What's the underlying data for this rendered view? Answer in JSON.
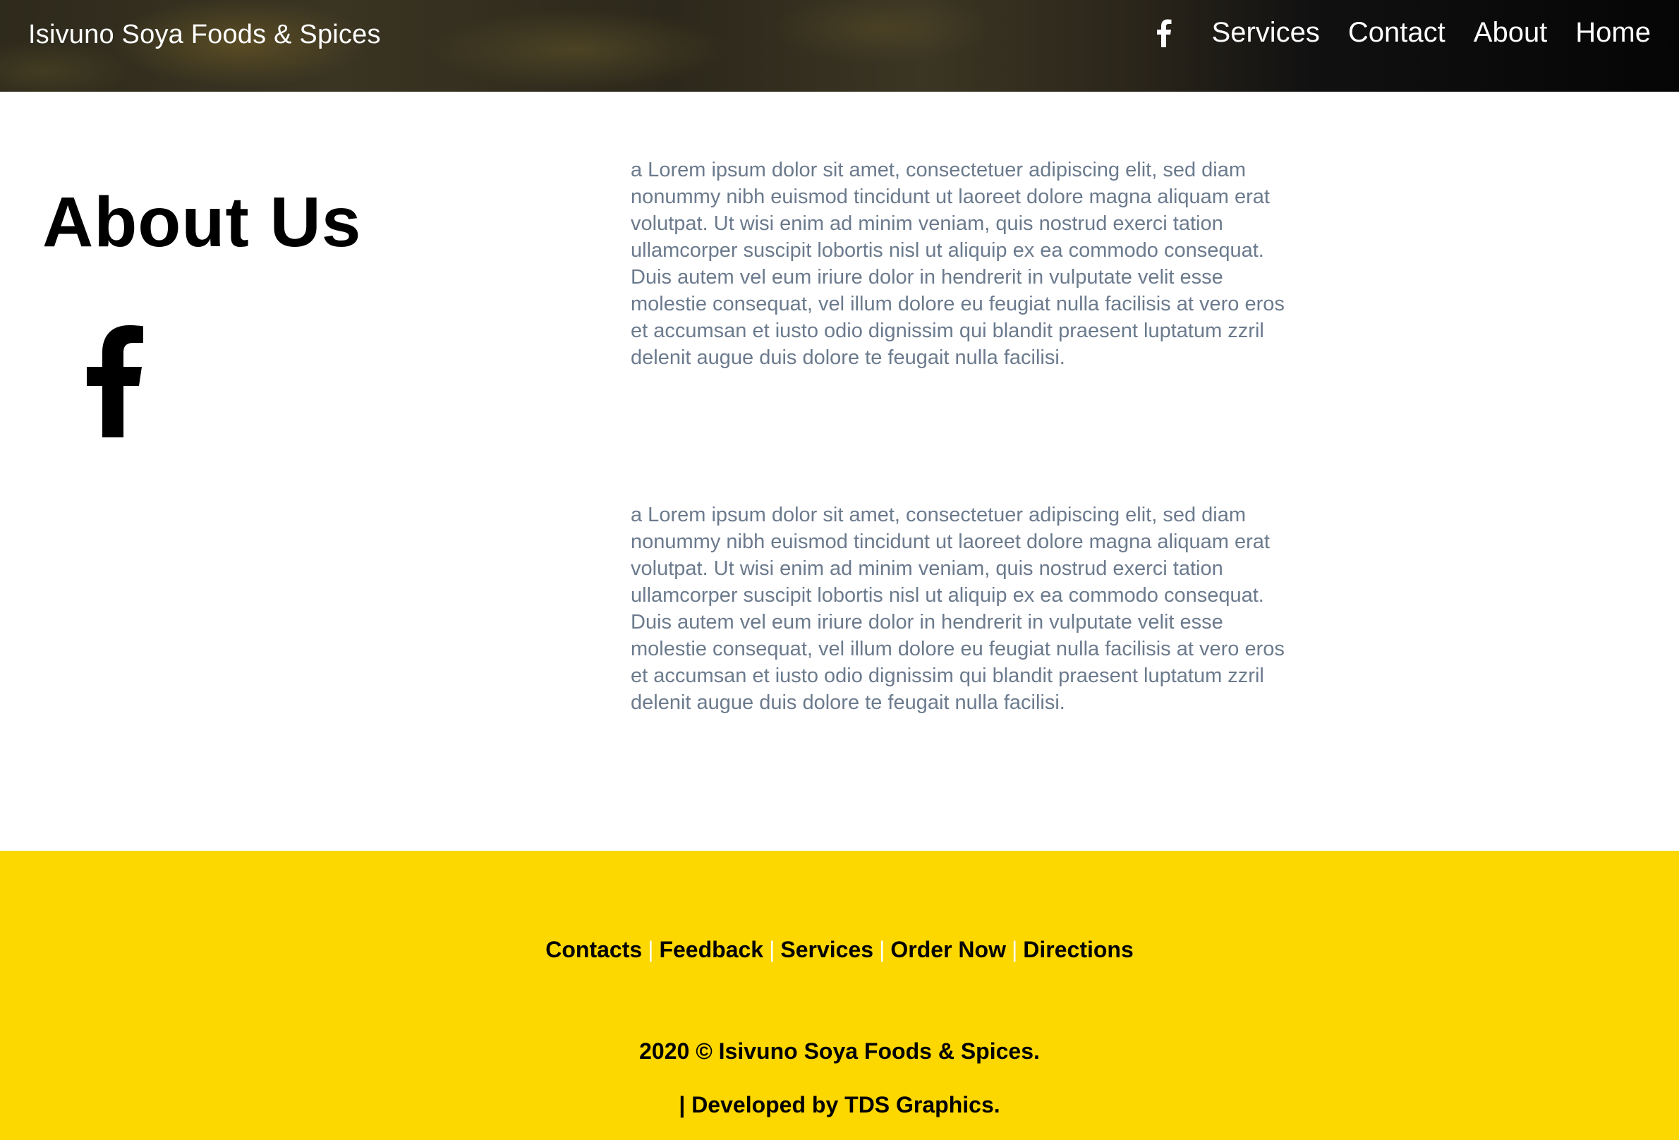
{
  "header": {
    "brand": "Isivuno Soya Foods & Spices",
    "nav_items": [
      {
        "label": "Services"
      },
      {
        "label": "Contact"
      },
      {
        "label": "About"
      },
      {
        "label": "Home"
      }
    ],
    "facebook_icon": "facebook-icon"
  },
  "main": {
    "title": "About Us",
    "facebook_icon": "facebook-icon",
    "paragraphs": [
      "a Lorem ipsum dolor sit amet, consectetuer adipiscing elit, sed diam nonummy nibh euismod tincidunt ut laoreet dolore magna aliquam erat volutpat. Ut wisi enim ad minim veniam, quis nostrud exerci tation ullamcorper suscipit lobortis nisl ut aliquip ex ea commodo consequat. Duis autem vel eum iriure dolor in hendrerit in vulputate velit esse molestie consequat, vel illum dolore eu feugiat nulla facilisis at vero eros et accumsan et iusto odio dignissim qui blandit praesent luptatum zzril delenit augue duis dolore te feugait nulla facilisi.",
      "a Lorem ipsum dolor sit amet, consectetuer adipiscing elit, sed diam nonummy nibh euismod tincidunt ut laoreet dolore magna aliquam erat volutpat. Ut wisi enim ad minim veniam, quis nostrud exerci tation ullamcorper suscipit lobortis nisl ut aliquip ex ea commodo consequat. Duis autem vel eum iriure dolor in hendrerit in vulputate velit esse molestie consequat, vel illum dolore eu feugiat nulla facilisis at vero eros et accumsan et iusto odio dignissim qui blandit praesent luptatum zzril delenit augue duis dolore te feugait nulla facilisi."
    ]
  },
  "footer": {
    "links": [
      {
        "label": "Contacts"
      },
      {
        "label": "Feedback"
      },
      {
        "label": "Services"
      },
      {
        "label": "Order Now"
      },
      {
        "label": "Directions"
      }
    ],
    "separator": "|",
    "copyright": "2020 © Isivuno Soya Foods & Spices.",
    "developed": "| Developed by TDS Graphics."
  },
  "colors": {
    "footer_bg": "#fdd700",
    "paragraph_text": "#6b7a8d",
    "separator": "#ffffff"
  }
}
